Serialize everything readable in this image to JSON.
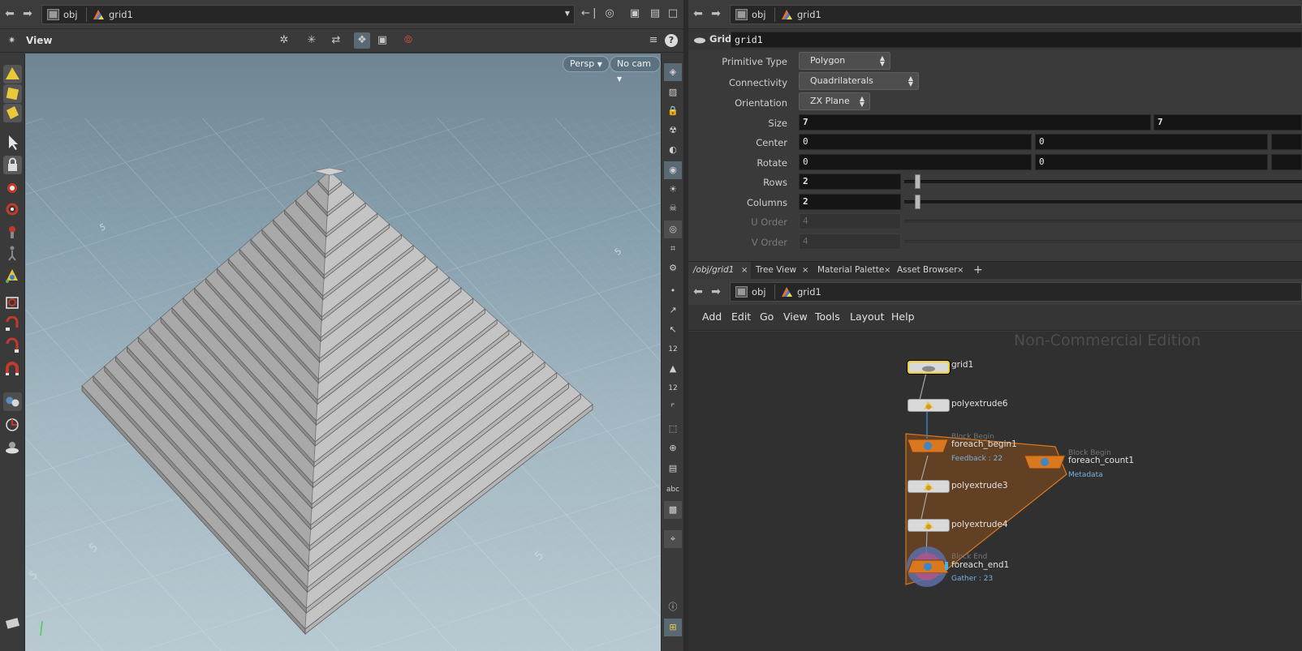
{
  "left_pane": {
    "path": {
      "segments": [
        {
          "label": "obj"
        },
        {
          "label": "grid1"
        }
      ]
    },
    "view_header": {
      "title": "View",
      "help_symbol": "?"
    },
    "viewport": {
      "persp_label": "Persp",
      "cam_label": "No cam"
    },
    "ground_labels": [
      "5",
      "5",
      "5",
      "5",
      "5"
    ],
    "right_tools": {
      "count_label_1": "12",
      "count_label_2": "12",
      "abc_label": "abc"
    }
  },
  "params": {
    "node_type": "Grid",
    "node_name": "grid1",
    "rows": [
      {
        "label": "Primitive Type",
        "kind": "menu",
        "value": "Polygon"
      },
      {
        "label": "Connectivity",
        "kind": "menu",
        "value": "Quadrilaterals"
      },
      {
        "label": "Orientation",
        "kind": "menu",
        "value": "ZX Plane"
      },
      {
        "label": "Size",
        "kind": "vec2",
        "values": [
          "7",
          "7"
        ]
      },
      {
        "label": "Center",
        "kind": "vec2",
        "values": [
          "0",
          "0"
        ]
      },
      {
        "label": "Rotate",
        "kind": "vec2",
        "values": [
          "0",
          "0"
        ]
      },
      {
        "label": "Rows",
        "kind": "int",
        "value": "2"
      },
      {
        "label": "Columns",
        "kind": "int",
        "value": "2"
      },
      {
        "label": "U Order",
        "kind": "int_disabled",
        "value": "4"
      },
      {
        "label": "V Order",
        "kind": "int_disabled",
        "value": "4"
      }
    ]
  },
  "tabs": [
    {
      "label": "/obj/grid1",
      "active": true
    },
    {
      "label": "Tree View",
      "active": false
    },
    {
      "label": "Material Palette",
      "active": false
    },
    {
      "label": "Asset Browser",
      "active": false
    }
  ],
  "tab_add_symbol": "+",
  "network": {
    "path": {
      "segments": [
        {
          "label": "obj"
        },
        {
          "label": "grid1"
        }
      ]
    },
    "menu": [
      "Add",
      "Edit",
      "Go",
      "View",
      "Tools",
      "Layout",
      "Help"
    ],
    "watermark": "Non-Commercial Edition",
    "nodes": {
      "grid1": {
        "label": "grid1"
      },
      "polyextrude6": {
        "label": "polyextrude6"
      },
      "foreach_begin1": {
        "label": "foreach_begin1",
        "tag": "Block Begin",
        "info": "Feedback : 22"
      },
      "foreach_count1": {
        "label": "foreach_count1",
        "tag": "Block Begin",
        "info": "Metadata"
      },
      "polyextrude3": {
        "label": "polyextrude3"
      },
      "polyextrude4": {
        "label": "polyextrude4"
      },
      "foreach_end1": {
        "label": "foreach_end1",
        "tag": "Block End",
        "info": "Gather : 23"
      }
    }
  },
  "colors": {
    "accent_selected": "#f2d12c",
    "block_orange": "#d9781f",
    "block_fill": "#8a4f1b",
    "info_blue": "#7ab1e0"
  }
}
